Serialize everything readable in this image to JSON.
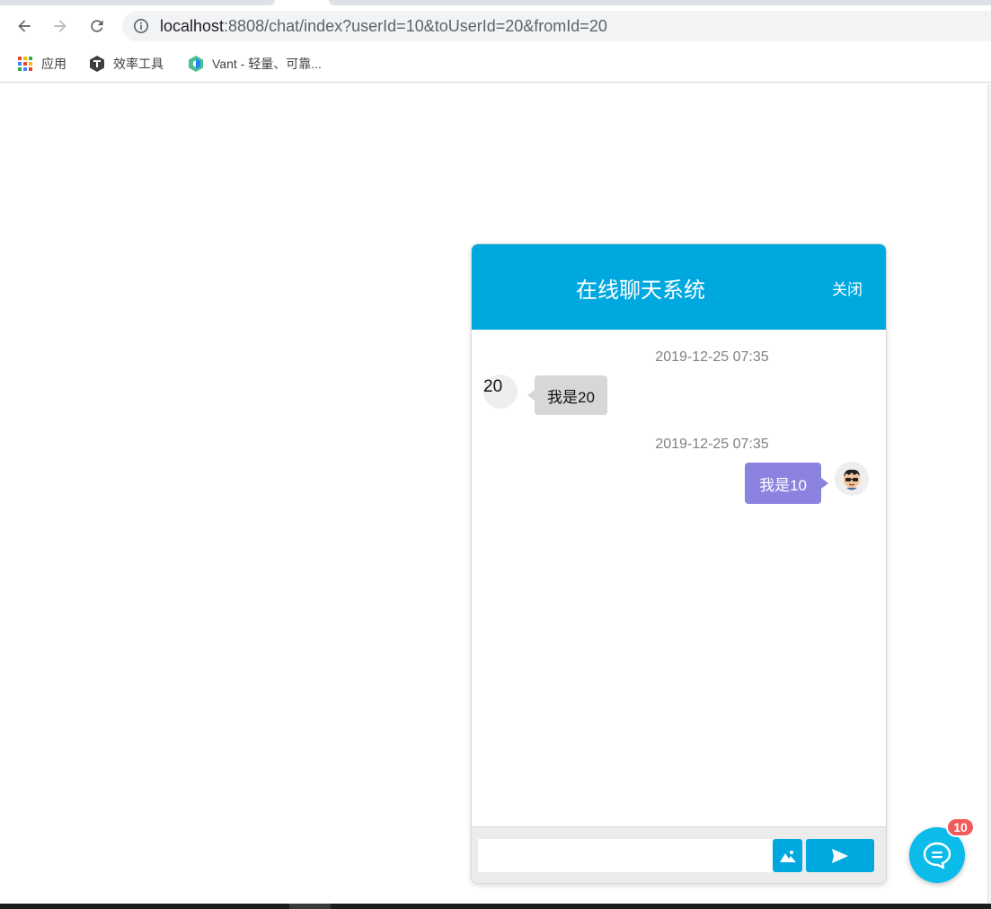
{
  "browser": {
    "url_host": "localhost",
    "url_rest": ":8808/chat/index?userId=10&toUserId=20&fromId=20",
    "bookmarks": [
      {
        "label": "应用",
        "icon": "apps-grid-icon"
      },
      {
        "label": "效率工具",
        "icon": "hexagon-t-icon"
      },
      {
        "label": "Vant - 轻量、可靠...",
        "icon": "vant-logo-icon"
      }
    ]
  },
  "chat": {
    "title": "在线聊天系统",
    "close_label": "关闭",
    "messages": [
      {
        "timestamp": "2019-12-25 07:35",
        "sender": "20",
        "text": "我是20",
        "side": "left"
      },
      {
        "timestamp": "2019-12-25 07:35",
        "sender": "10",
        "text": "我是10",
        "side": "right"
      }
    ],
    "input": {
      "value": "",
      "placeholder": ""
    },
    "accent_color": "#00a8e0",
    "own_bubble_color": "#8c83e0"
  },
  "fab": {
    "badge_count": "10",
    "icon": "chat-bubble-icon"
  }
}
